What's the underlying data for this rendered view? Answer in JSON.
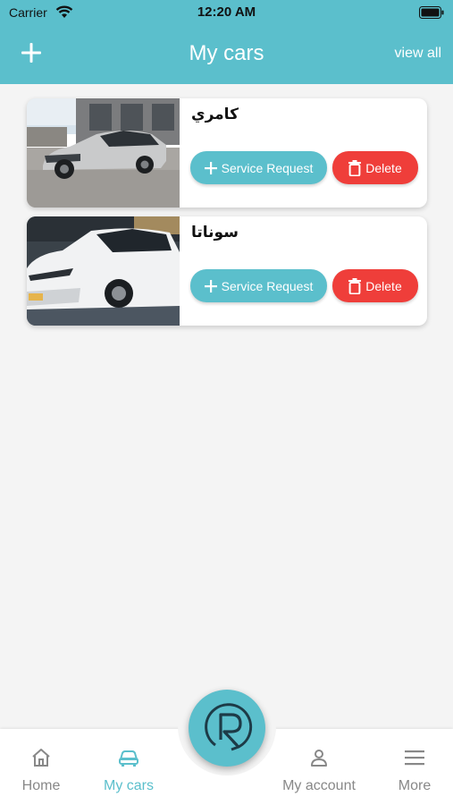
{
  "status_bar": {
    "carrier": "Carrier",
    "time": "12:20 AM"
  },
  "nav": {
    "title": "My cars",
    "view_all": "view all",
    "add_icon": "plus-icon"
  },
  "cars": [
    {
      "name": "كامري",
      "photo": "silver-sedan",
      "service_label": "Service Request",
      "delete_label": "Delete"
    },
    {
      "name": "سوناتا",
      "photo": "white-sedan",
      "service_label": "Service Request",
      "delete_label": "Delete"
    }
  ],
  "tab_bar": {
    "home": "Home",
    "my_cars": "My cars",
    "my_account": "My account",
    "more": "More",
    "active": "my_cars"
  },
  "colors": {
    "accent": "#5bbfcc",
    "danger": "#ef3e3a",
    "inactive": "#888888"
  }
}
